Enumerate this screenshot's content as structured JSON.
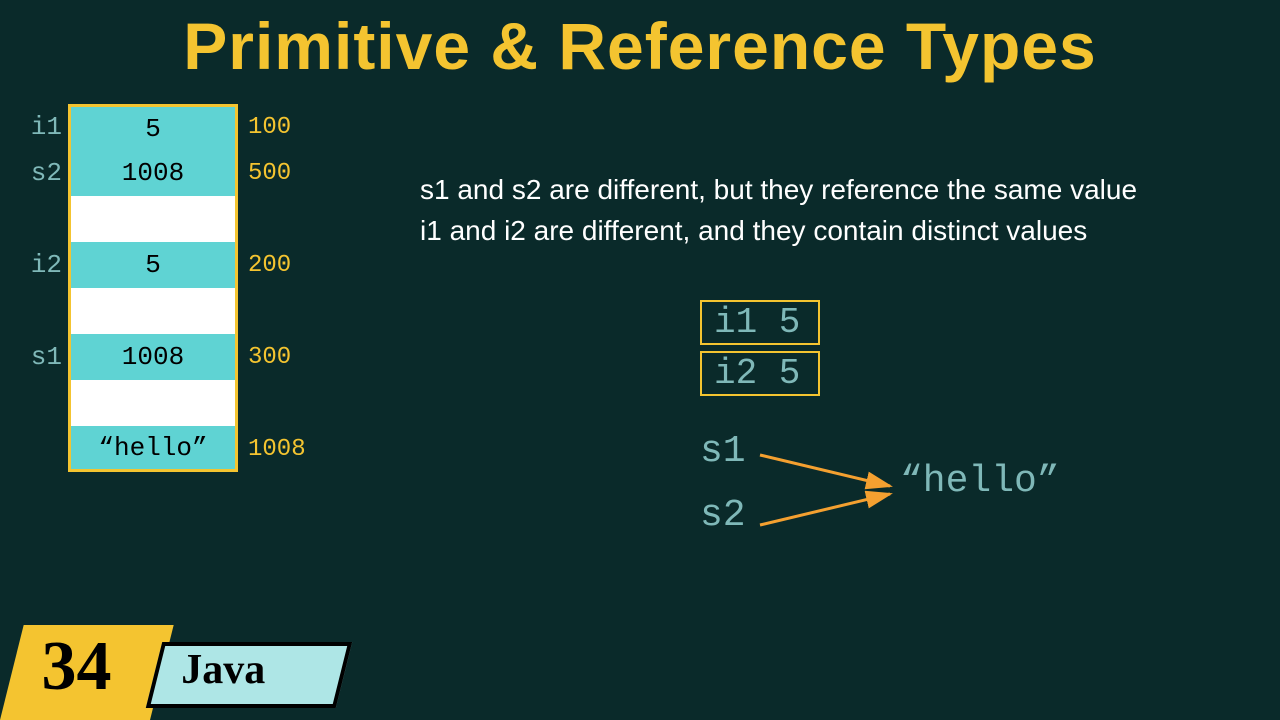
{
  "title": "Primitive & Reference Types",
  "memory_rows": [
    {
      "label": "i1",
      "value": "5",
      "addr": "100",
      "color": "cyan",
      "top": true
    },
    {
      "label": "s2",
      "value": "1008",
      "addr": "500",
      "color": "cyan"
    },
    {
      "label": "",
      "value": "",
      "addr": "",
      "color": "white"
    },
    {
      "label": "i2",
      "value": "5",
      "addr": "200",
      "color": "cyan"
    },
    {
      "label": "",
      "value": "",
      "addr": "",
      "color": "white"
    },
    {
      "label": "s1",
      "value": "1008",
      "addr": "300",
      "color": "cyan"
    },
    {
      "label": "",
      "value": "",
      "addr": "",
      "color": "white"
    },
    {
      "label": "",
      "value": "“hello”",
      "addr": "1008",
      "color": "cyan",
      "bot": true
    }
  ],
  "explain_line1": "s1 and s2 are different, but they reference the same value",
  "explain_line2": "i1 and i2 are different, and they contain distinct values",
  "box_i1": "i1 5",
  "box_i2": "i2 5",
  "ref_s1": "s1",
  "ref_s2": "s2",
  "ref_hello": "“hello”",
  "badge_number": "34",
  "badge_lang": "Java"
}
